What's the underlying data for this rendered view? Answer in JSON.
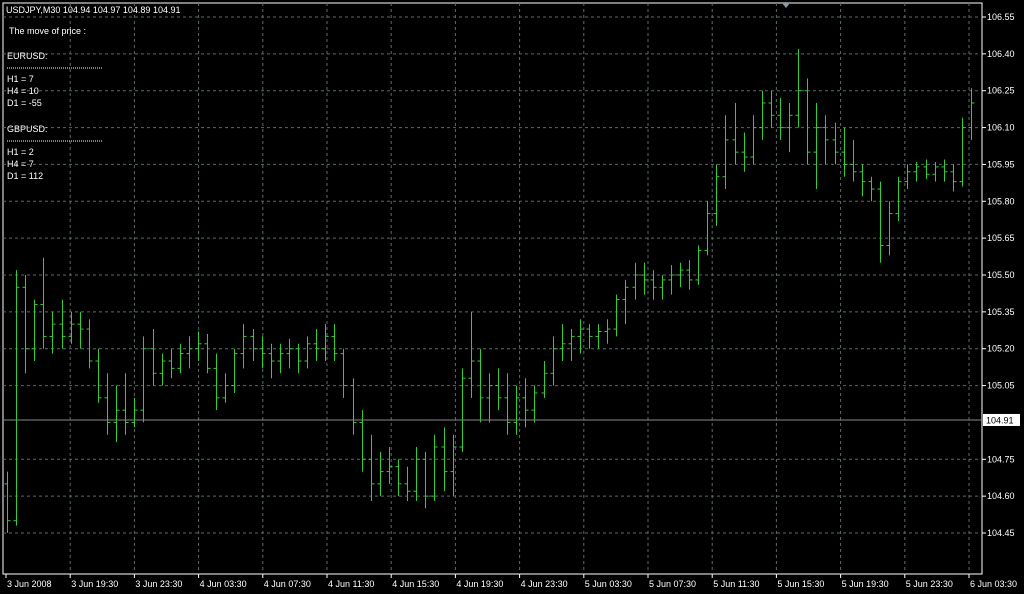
{
  "header": {
    "symbol_line": "USDJPY,M30  104.94 104.97 104.89 104.91"
  },
  "panel": {
    "title": "The move of price :",
    "groups": [
      {
        "name": "EURUSD:",
        "lines": [
          "H1 = 7",
          "H4 = 10",
          "D1 = -55"
        ]
      },
      {
        "name": "GBPUSD:",
        "lines": [
          "H1 = 2",
          "H4 = 7",
          "D1 = 112"
        ]
      }
    ]
  },
  "colors": {
    "background": "#000000",
    "grid": "#5a6a6a",
    "bars": "#33cc33",
    "text": "#ffffff",
    "price_line": "#8a8a8a"
  },
  "chart_data": {
    "type": "ohlc-bar",
    "symbol": "USDJPY",
    "timeframe": "M30",
    "current_price": "104.91",
    "ylim": [
      104.4,
      106.6
    ],
    "y_ticks": [
      "106.55",
      "106.40",
      "106.25",
      "106.10",
      "105.95",
      "105.80",
      "105.65",
      "105.50",
      "105.35",
      "105.20",
      "105.05",
      "104.75",
      "104.60",
      "104.45"
    ],
    "x_ticks": [
      "3 Jun 2008",
      "3 Jun 19:30",
      "3 Jun 23:30",
      "4 Jun 03:30",
      "4 Jun 07:30",
      "4 Jun 11:30",
      "4 Jun 15:30",
      "4 Jun 19:30",
      "4 Jun 23:30",
      "5 Jun 03:30",
      "5 Jun 07:30",
      "5 Jun 11:30",
      "5 Jun 15:30",
      "5 Jun 19:30",
      "5 Jun 23:30",
      "6 Jun 03:30"
    ],
    "bars": [
      [
        104.65,
        104.7,
        104.45,
        104.5
      ],
      [
        104.5,
        105.52,
        104.48,
        105.45
      ],
      [
        105.45,
        105.5,
        105.1,
        105.2
      ],
      [
        105.2,
        105.4,
        105.15,
        105.38
      ],
      [
        105.38,
        105.57,
        105.2,
        105.25
      ],
      [
        105.25,
        105.35,
        105.18,
        105.3
      ],
      [
        105.3,
        105.4,
        105.2,
        105.25
      ],
      [
        105.25,
        105.35,
        105.22,
        105.3
      ],
      [
        105.3,
        105.35,
        105.2,
        105.28
      ],
      [
        105.28,
        105.32,
        105.12,
        105.15
      ],
      [
        105.15,
        105.2,
        104.98,
        105.0
      ],
      [
        105.0,
        105.1,
        104.85,
        104.9
      ],
      [
        104.9,
        105.05,
        104.82,
        104.95
      ],
      [
        104.95,
        105.1,
        104.85,
        104.9
      ],
      [
        104.9,
        105.0,
        104.88,
        104.95
      ],
      [
        104.95,
        105.25,
        104.9,
        105.2
      ],
      [
        105.2,
        105.28,
        105.05,
        105.1
      ],
      [
        105.1,
        105.18,
        105.05,
        105.15
      ],
      [
        105.15,
        105.2,
        105.08,
        105.12
      ],
      [
        105.12,
        105.22,
        105.1,
        105.18
      ],
      [
        105.18,
        105.25,
        105.12,
        105.2
      ],
      [
        105.2,
        105.27,
        105.15,
        105.22
      ],
      [
        105.22,
        105.26,
        105.1,
        105.12
      ],
      [
        105.12,
        105.18,
        104.95,
        105.0
      ],
      [
        105.0,
        105.1,
        104.98,
        105.05
      ],
      [
        105.05,
        105.2,
        105.02,
        105.18
      ],
      [
        105.18,
        105.3,
        105.12,
        105.25
      ],
      [
        105.25,
        105.28,
        105.15,
        105.2
      ],
      [
        105.2,
        105.25,
        105.12,
        105.18
      ],
      [
        105.18,
        105.22,
        105.08,
        105.15
      ],
      [
        105.15,
        105.22,
        105.1,
        105.18
      ],
      [
        105.18,
        105.24,
        105.12,
        105.2
      ],
      [
        105.2,
        105.22,
        105.1,
        105.15
      ],
      [
        105.15,
        105.25,
        105.12,
        105.22
      ],
      [
        105.22,
        105.28,
        105.15,
        105.2
      ],
      [
        105.2,
        105.3,
        105.15,
        105.25
      ],
      [
        105.25,
        105.3,
        105.15,
        105.18
      ],
      [
        105.18,
        105.2,
        105.0,
        105.05
      ],
      [
        105.05,
        105.08,
        104.85,
        104.9
      ],
      [
        104.9,
        104.95,
        104.7,
        104.75
      ],
      [
        104.75,
        104.85,
        104.58,
        104.65
      ],
      [
        104.65,
        104.78,
        104.6,
        104.7
      ],
      [
        104.7,
        104.8,
        104.65,
        104.72
      ],
      [
        104.72,
        104.75,
        104.6,
        104.65
      ],
      [
        104.65,
        104.72,
        104.58,
        104.62
      ],
      [
        104.62,
        104.8,
        104.58,
        104.75
      ],
      [
        104.75,
        104.78,
        104.55,
        104.6
      ],
      [
        104.6,
        104.85,
        104.58,
        104.8
      ],
      [
        104.8,
        104.88,
        104.62,
        104.7
      ],
      [
        104.7,
        104.85,
        104.6,
        104.8
      ],
      [
        104.8,
        105.12,
        104.78,
        105.08
      ],
      [
        105.08,
        105.35,
        105.0,
        105.15
      ],
      [
        105.15,
        105.2,
        104.9,
        105.0
      ],
      [
        105.0,
        105.1,
        104.9,
        105.05
      ],
      [
        105.05,
        105.12,
        104.95,
        105.0
      ],
      [
        105.0,
        105.1,
        104.85,
        104.9
      ],
      [
        104.9,
        105.05,
        104.85,
        105.0
      ],
      [
        105.0,
        105.08,
        104.88,
        104.95
      ],
      [
        104.95,
        105.05,
        104.9,
        105.02
      ],
      [
        105.02,
        105.15,
        105.0,
        105.1
      ],
      [
        105.1,
        105.25,
        105.05,
        105.2
      ],
      [
        105.2,
        105.3,
        105.15,
        105.22
      ],
      [
        105.22,
        105.28,
        105.15,
        105.25
      ],
      [
        105.25,
        105.32,
        105.18,
        105.28
      ],
      [
        105.28,
        105.3,
        105.2,
        105.25
      ],
      [
        105.25,
        105.3,
        105.2,
        105.27
      ],
      [
        105.27,
        105.32,
        105.22,
        105.28
      ],
      [
        105.28,
        105.42,
        105.25,
        105.4
      ],
      [
        105.4,
        105.48,
        105.3,
        105.45
      ],
      [
        105.45,
        105.55,
        105.4,
        105.5
      ],
      [
        105.5,
        105.55,
        105.42,
        105.48
      ],
      [
        105.48,
        105.52,
        105.4,
        105.45
      ],
      [
        105.45,
        105.5,
        105.4,
        105.48
      ],
      [
        105.48,
        105.54,
        105.42,
        105.5
      ],
      [
        105.5,
        105.55,
        105.45,
        105.52
      ],
      [
        105.52,
        105.56,
        105.44,
        105.48
      ],
      [
        105.48,
        105.62,
        105.46,
        105.6
      ],
      [
        105.6,
        105.8,
        105.58,
        105.75
      ],
      [
        105.75,
        105.95,
        105.7,
        105.9
      ],
      [
        105.9,
        106.15,
        105.85,
        106.05
      ],
      [
        106.05,
        106.2,
        105.95,
        106.0
      ],
      [
        106.0,
        106.08,
        105.92,
        105.98
      ],
      [
        105.98,
        106.15,
        105.95,
        106.1
      ],
      [
        106.1,
        106.25,
        106.05,
        106.2
      ],
      [
        106.2,
        106.25,
        106.1,
        106.15
      ],
      [
        106.15,
        106.22,
        106.05,
        106.1
      ],
      [
        106.1,
        106.2,
        106.0,
        106.15
      ],
      [
        106.15,
        106.42,
        106.1,
        106.25
      ],
      [
        106.25,
        106.3,
        105.95,
        106.0
      ],
      [
        106.0,
        106.2,
        105.85,
        106.1
      ],
      [
        106.1,
        106.15,
        105.95,
        106.05
      ],
      [
        106.05,
        106.12,
        105.95,
        106.0
      ],
      [
        106.0,
        106.1,
        105.9,
        105.95
      ],
      [
        105.95,
        106.05,
        105.88,
        105.92
      ],
      [
        105.92,
        105.95,
        105.82,
        105.88
      ],
      [
        105.88,
        105.9,
        105.8,
        105.85
      ],
      [
        105.85,
        105.88,
        105.55,
        105.62
      ],
      [
        105.62,
        105.8,
        105.58,
        105.75
      ],
      [
        105.75,
        105.9,
        105.72,
        105.88
      ],
      [
        105.88,
        105.95,
        105.85,
        105.92
      ],
      [
        105.92,
        105.96,
        105.88,
        105.94
      ],
      [
        105.94,
        105.97,
        105.89,
        105.91
      ],
      [
        105.91,
        105.96,
        105.88,
        105.94
      ],
      [
        105.94,
        105.97,
        105.88,
        105.92
      ],
      [
        105.92,
        105.95,
        105.84,
        105.88
      ],
      [
        105.88,
        106.14,
        105.86,
        106.1
      ],
      [
        106.1,
        106.26,
        106.05,
        106.2
      ]
    ]
  },
  "date_label": "3 Jun 2008"
}
